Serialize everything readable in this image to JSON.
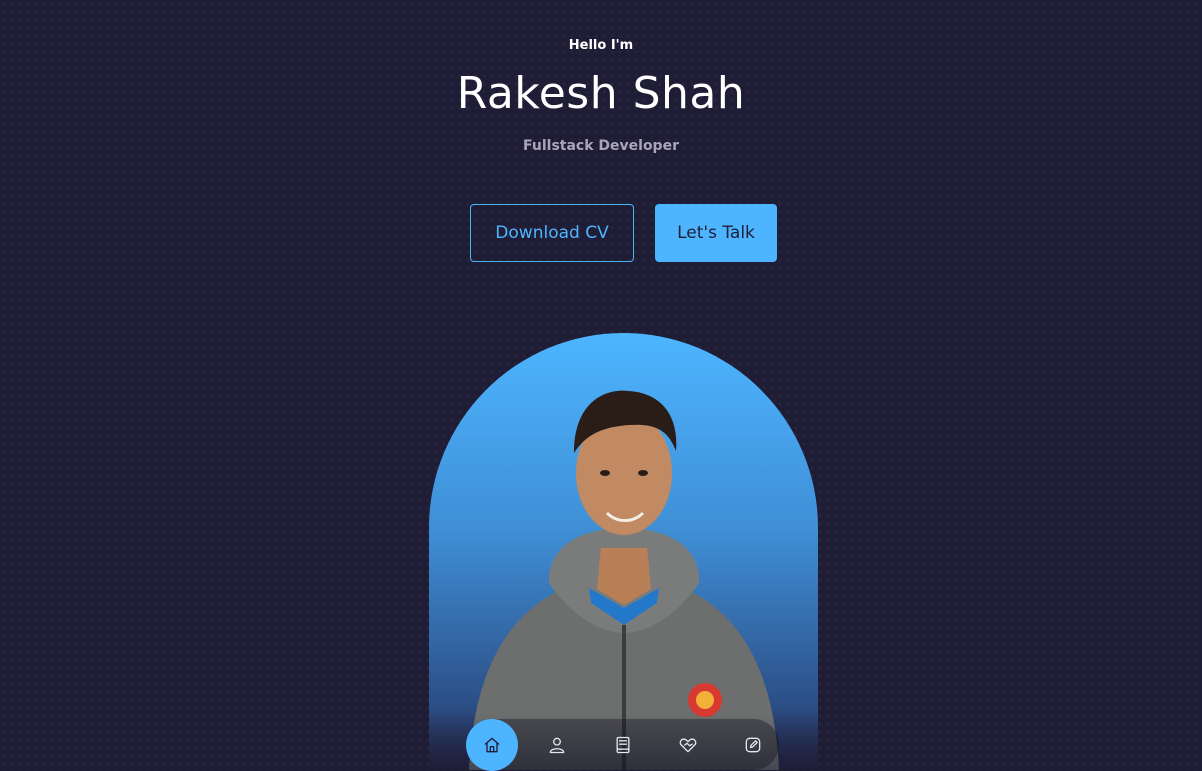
{
  "hero": {
    "greeting": "Hello I'm",
    "name": "Rakesh Shah",
    "role": "Fullstack Developer"
  },
  "cta": {
    "download_label": "Download CV",
    "talk_label": "Let's Talk"
  },
  "nav": {
    "items": [
      {
        "icon": "home-icon",
        "active": true
      },
      {
        "icon": "user-icon",
        "active": false
      },
      {
        "icon": "book-icon",
        "active": false
      },
      {
        "icon": "services-icon",
        "active": false
      },
      {
        "icon": "message-icon",
        "active": false
      }
    ]
  },
  "colors": {
    "background": "#1f1d36",
    "accent": "#4db5ff",
    "muted_text": "#a9a6b8"
  }
}
